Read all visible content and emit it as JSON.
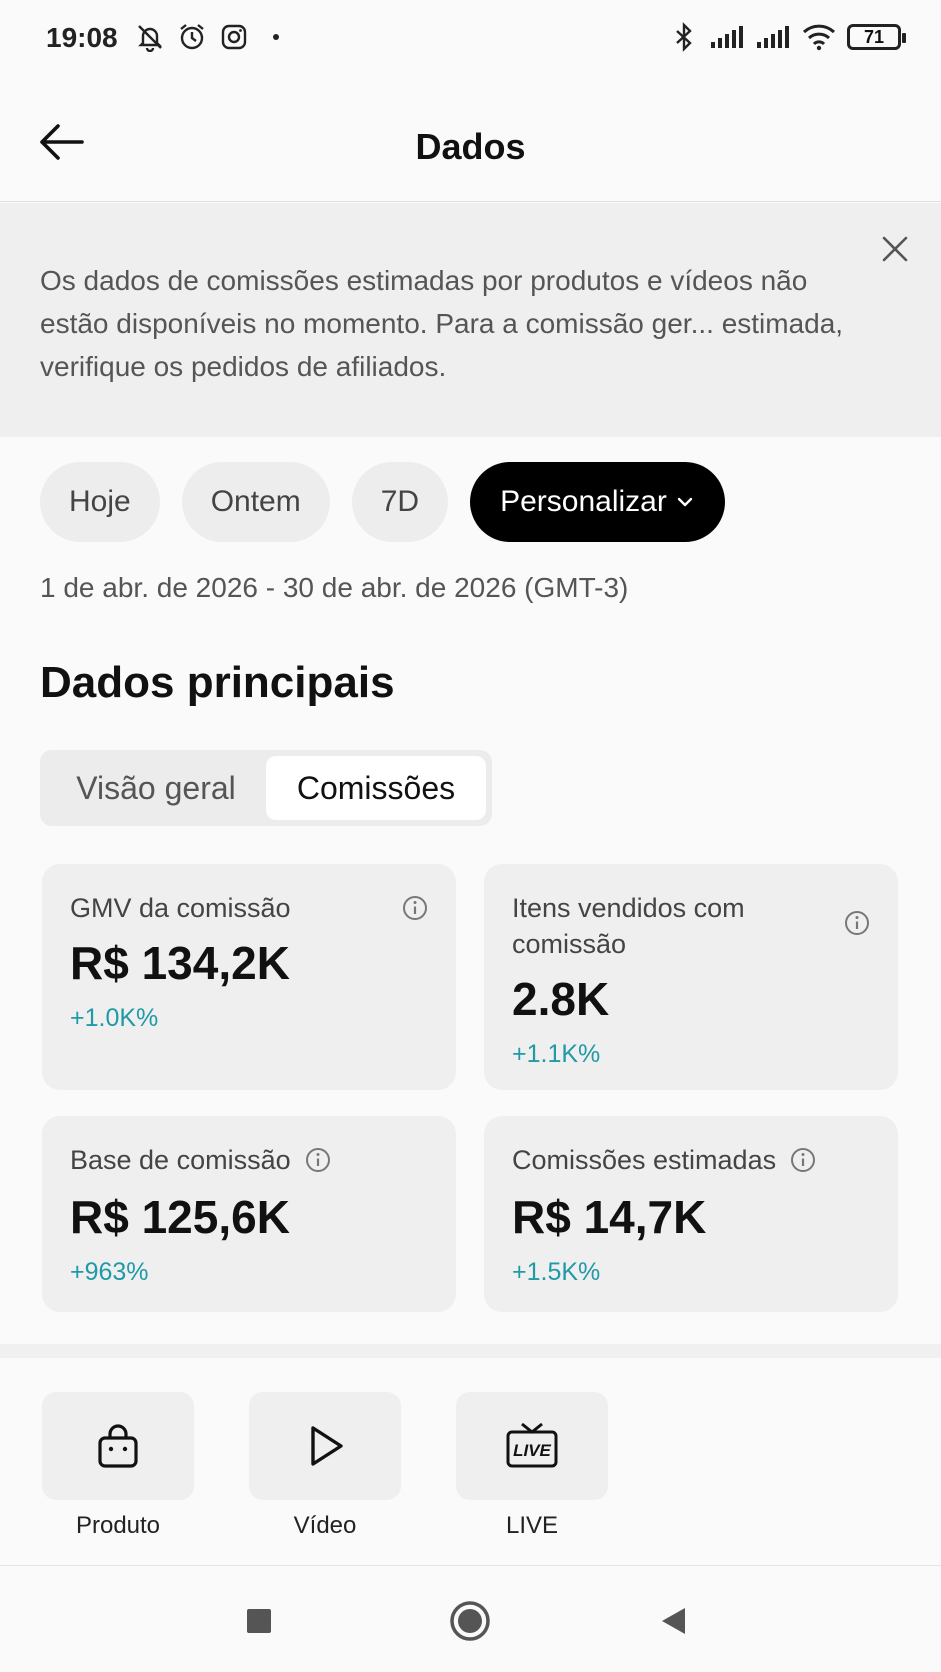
{
  "status_bar": {
    "time": "19:08",
    "battery": "71",
    "left_icons": [
      "bell-off-icon",
      "alarm-icon",
      "instagram-icon",
      "dot-icon"
    ],
    "right_icons": [
      "bluetooth-icon",
      "signal-icon",
      "signal-icon",
      "wifi-icon",
      "battery-icon"
    ]
  },
  "header": {
    "title": "Dados",
    "back_icon": "arrow-left-icon"
  },
  "notice": {
    "text": "Os dados de comissões estimadas por produtos e vídeos não estão disponíveis no momento. Para a comissão ger... estimada, verifique os pedidos de afiliados.",
    "close_icon": "close-icon"
  },
  "filters": {
    "chips": [
      "Hoje",
      "Ontem",
      "7D"
    ],
    "custom_label": "Personalizar",
    "date_range": "1 de abr. de 2026 - 30 de abr. de 2026 (GMT-3)"
  },
  "main": {
    "section_title": "Dados principais",
    "tabs": [
      "Visão geral",
      "Comissões"
    ],
    "active_tab": "Comissões",
    "cards": [
      {
        "label": "GMV da comissão",
        "value": "R$ 134,2K",
        "delta": "+1.0K%"
      },
      {
        "label": "Itens vendidos com comissão",
        "value": "2.8K",
        "delta": "+1.1K%"
      },
      {
        "label": "Base de comissão",
        "value": "R$ 125,6K",
        "delta": "+963%"
      },
      {
        "label": "Comissões estimadas",
        "value": "R$ 14,7K",
        "delta": "+1.5K%"
      }
    ],
    "delta_color": "#1f9aa6"
  },
  "shortcuts": [
    {
      "label": "Produto",
      "icon": "shopping-bag-icon"
    },
    {
      "label": "Vídeo",
      "icon": "play-icon"
    },
    {
      "label": "LIVE",
      "icon": "live-tv-icon"
    }
  ],
  "system_nav": [
    "recents-square-icon",
    "home-circle-icon",
    "back-triangle-icon"
  ]
}
